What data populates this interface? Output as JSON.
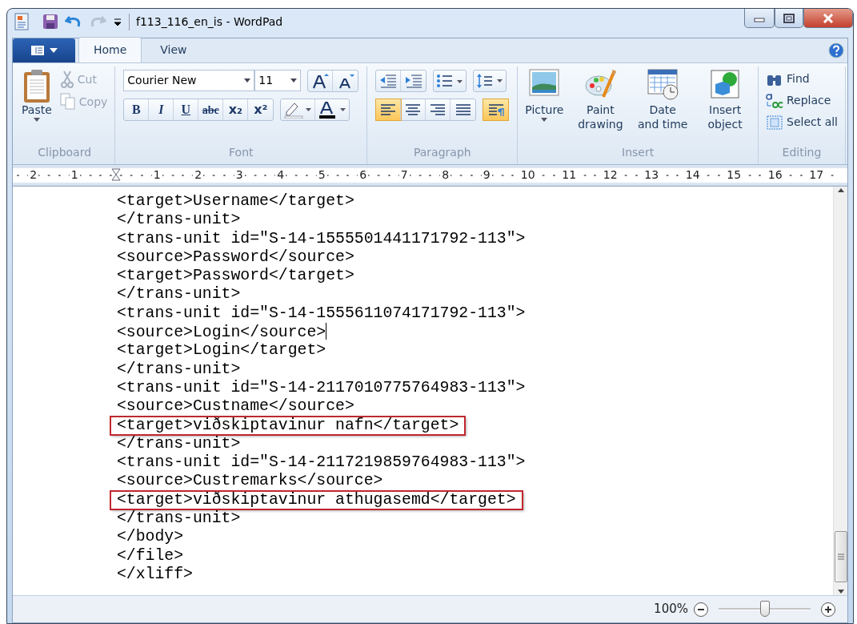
{
  "window": {
    "title": "f113_116_en_is - WordPad"
  },
  "tabs": [
    {
      "label": "Home",
      "selected": true
    },
    {
      "label": "View",
      "selected": false
    }
  ],
  "ribbon": {
    "groups": [
      {
        "kind": "clipboard",
        "label": "Clipboard",
        "paste": "Paste",
        "items": [
          {
            "label": "Cut",
            "disabled": true
          },
          {
            "label": "Copy",
            "disabled": true
          }
        ]
      },
      {
        "kind": "font",
        "label": "Font",
        "font_name": "Courier New",
        "font_size": "11",
        "styles": [
          {
            "glyph": "B"
          },
          {
            "glyph": "I"
          },
          {
            "glyph": "U"
          },
          {
            "glyph": "abc"
          },
          {
            "glyph": "x₂"
          },
          {
            "glyph": "x²"
          }
        ]
      },
      {
        "kind": "paragraph",
        "label": "Paragraph",
        "alignments": [
          {
            "selected": true
          },
          {
            "selected": false
          },
          {
            "selected": false
          },
          {
            "selected": false
          }
        ],
        "paragraph_highlighted": true
      },
      {
        "kind": "insert",
        "label": "Insert",
        "items": [
          {
            "label": "Picture",
            "dropdown": true
          },
          {
            "label": "Paint drawing",
            "dropdown": false
          },
          {
            "label": "Date and time",
            "dropdown": false
          },
          {
            "label": "Insert object",
            "dropdown": false
          }
        ]
      },
      {
        "kind": "editing",
        "label": "Editing",
        "items": [
          "Find",
          "Replace",
          "Select all"
        ]
      }
    ]
  },
  "ruler": {
    "marks_before_indent": [
      "2",
      "1"
    ],
    "marks": [
      "1",
      "2",
      "3",
      "4",
      "5",
      "6",
      "7",
      "8",
      "9",
      "10",
      "11",
      "12",
      "13",
      "14",
      "15",
      "16",
      "17"
    ]
  },
  "document": {
    "lines": [
      {
        "text": "<target>Username</target>",
        "boxed": false,
        "caret": false
      },
      {
        "text": "</trans-unit>",
        "boxed": false,
        "caret": false
      },
      {
        "text": "<trans-unit id=\"S-14-1555501441171792-113\">",
        "boxed": false,
        "caret": false
      },
      {
        "text": "<source>Password</source>",
        "boxed": false,
        "caret": false
      },
      {
        "text": "<target>Password</target>",
        "boxed": false,
        "caret": false
      },
      {
        "text": "</trans-unit>",
        "boxed": false,
        "caret": false
      },
      {
        "text": "<trans-unit id=\"S-14-1555611074171792-113\">",
        "boxed": false,
        "caret": false
      },
      {
        "text": "<source>Login</source>",
        "boxed": false,
        "caret": true
      },
      {
        "text": "<target>Login</target>",
        "boxed": false,
        "caret": false
      },
      {
        "text": "</trans-unit>",
        "boxed": false,
        "caret": false
      },
      {
        "text": "<trans-unit id=\"S-14-2117010775764983-113\">",
        "boxed": false,
        "caret": false
      },
      {
        "text": "<source>Custname</source>",
        "boxed": false,
        "caret": false
      },
      {
        "text": "<target>viðskiptavinur nafn</target>",
        "boxed": true,
        "caret": false
      },
      {
        "text": "</trans-unit>",
        "boxed": false,
        "caret": false
      },
      {
        "text": "<trans-unit id=\"S-14-2117219859764983-113\">",
        "boxed": false,
        "caret": false
      },
      {
        "text": "<source>Custremarks</source>",
        "boxed": false,
        "caret": false
      },
      {
        "text": "<target>viðskiptavinur athugasemd</target>",
        "boxed": true,
        "caret": false
      },
      {
        "text": "</trans-unit>",
        "boxed": false,
        "caret": false
      },
      {
        "text": "</body>",
        "boxed": false,
        "caret": false
      },
      {
        "text": "</file>",
        "boxed": false,
        "caret": false
      },
      {
        "text": "</xliff>",
        "boxed": false,
        "caret": false
      }
    ]
  },
  "status_bar": {
    "zoom": "100%",
    "level": 0.5
  }
}
